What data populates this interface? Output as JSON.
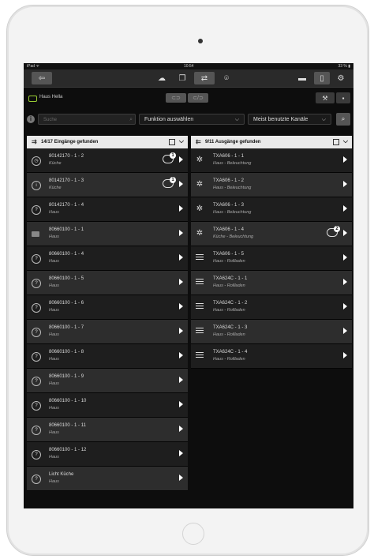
{
  "status_bar": {
    "left": "iPad ᯤ",
    "time": "10:54",
    "battery": "33 % ▮"
  },
  "toolbar": {
    "back_icon": "back-arrow-icon",
    "tabs": [
      "cloud",
      "pages",
      "switch-active",
      "location"
    ],
    "right_icons": [
      "minus",
      "document",
      "gear"
    ]
  },
  "house": {
    "name": "Haus Hella"
  },
  "filter": {
    "search_placeholder": "Suche",
    "function_select": "Funktion auswählen",
    "sort_select": "Meist benutzte Kanäle"
  },
  "inputs_panel": {
    "title": "14/17 Eingänge gefunden",
    "rows": [
      {
        "title": "80142170 - 1 - 2",
        "subtitle": "Küche",
        "icon": "timer",
        "badge": "1"
      },
      {
        "title": "80142170 - 1 - 3",
        "subtitle": "Küche",
        "icon": "info",
        "badge": "1"
      },
      {
        "title": "80142170 - 1 - 4",
        "subtitle": "Haus",
        "icon": "question",
        "badge": ""
      },
      {
        "title": "80660100 - 1 - 1",
        "subtitle": "Haus",
        "icon": "device",
        "badge": ""
      },
      {
        "title": "80660100 - 1 - 4",
        "subtitle": "Haus",
        "icon": "question",
        "badge": ""
      },
      {
        "title": "80660100 - 1 - 5",
        "subtitle": "Haus",
        "icon": "question",
        "badge": ""
      },
      {
        "title": "80660100 - 1 - 6",
        "subtitle": "Haus",
        "icon": "question",
        "badge": ""
      },
      {
        "title": "80660100 - 1 - 7",
        "subtitle": "Haus",
        "icon": "question",
        "badge": ""
      },
      {
        "title": "80660100 - 1 - 8",
        "subtitle": "Haus",
        "icon": "question",
        "badge": ""
      },
      {
        "title": "80660100 - 1 - 9",
        "subtitle": "Haus",
        "icon": "question",
        "badge": ""
      },
      {
        "title": "80660100 - 1 - 10",
        "subtitle": "Haus",
        "icon": "question",
        "badge": ""
      },
      {
        "title": "80660100 - 1 - 11",
        "subtitle": "Haus",
        "icon": "question",
        "badge": ""
      },
      {
        "title": "80660100 - 1 - 12",
        "subtitle": "Haus",
        "icon": "question",
        "badge": ""
      },
      {
        "title": "Licht Küche",
        "subtitle": "Haus",
        "icon": "question",
        "badge": ""
      }
    ]
  },
  "outputs_panel": {
    "title": "9/11 Ausgänge gefunden",
    "rows": [
      {
        "title": "TXA606 - 1 - 1",
        "subtitle": "Haus - Beleuchtung",
        "icon": "light",
        "badge": ""
      },
      {
        "title": "TXA606 - 1 - 2",
        "subtitle": "Haus - Beleuchtung",
        "icon": "light",
        "badge": ""
      },
      {
        "title": "TXA606 - 1 - 3",
        "subtitle": "Haus - Beleuchtung",
        "icon": "light",
        "badge": ""
      },
      {
        "title": "TXA606 - 1 - 4",
        "subtitle": "Küche - Beleuchtung",
        "icon": "light",
        "badge": "2"
      },
      {
        "title": "TXA606 - 1 - 5",
        "subtitle": "Haus - Rollladen",
        "icon": "shutter",
        "badge": ""
      },
      {
        "title": "TXA624C - 1 - 1",
        "subtitle": "Haus - Rollladen",
        "icon": "shutter",
        "badge": ""
      },
      {
        "title": "TXA624C - 1 - 2",
        "subtitle": "Haus - Rollladen",
        "icon": "shutter",
        "badge": ""
      },
      {
        "title": "TXA624C - 1 - 3",
        "subtitle": "Haus - Rollladen",
        "icon": "shutter",
        "badge": ""
      },
      {
        "title": "TXA624C - 1 - 4",
        "subtitle": "Haus - Rollladen",
        "icon": "shutter",
        "badge": ""
      }
    ]
  },
  "colors": {
    "background": "#0d0d0d",
    "row_odd": "#1e1e1e",
    "row_even": "#2d2d2d",
    "header": "#e9e9e9",
    "house_accent": "#99cc33"
  }
}
